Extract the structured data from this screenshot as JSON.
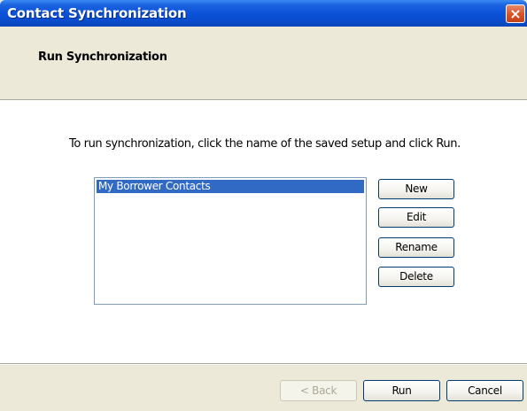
{
  "window": {
    "title": "Contact Synchronization",
    "close_icon": "×"
  },
  "header": {
    "title": "Run Synchronization"
  },
  "content": {
    "instruction": "To run synchronization, click the name of the saved setup and click Run.",
    "setups": [
      {
        "label": "My Borrower Contacts",
        "selected": true
      }
    ]
  },
  "side_buttons": {
    "new": "New",
    "edit": "Edit",
    "rename": "Rename",
    "delete": "Delete"
  },
  "footer": {
    "back": "< Back",
    "back_enabled": false,
    "run": "Run",
    "cancel": "Cancel"
  },
  "colors": {
    "title_bar": "#0a52d8",
    "selection": "#316ac5",
    "close_button": "#d8562a"
  }
}
